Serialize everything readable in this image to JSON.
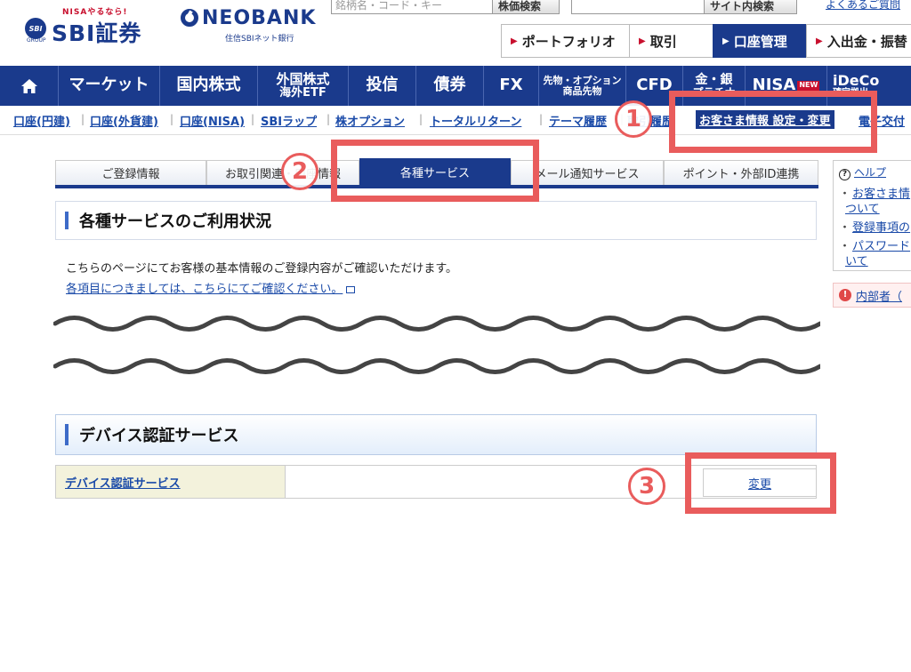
{
  "header": {
    "sbi_logo": {
      "tagline": "NISAやるなら!",
      "emblem": "SBI",
      "emblem_sub": "GROUP",
      "name": "SBI証券"
    },
    "neobank_logo": {
      "name": "NEOBANK",
      "sub": "住信SBIネット銀行"
    },
    "stock_search": {
      "placeholder": "銘柄名・コード・キー",
      "button": "株価検索"
    },
    "site_search": {
      "button": "サイト内検索"
    },
    "faq_link": "よくあるご質問",
    "top_tabs": [
      "ポートフォリオ",
      "取引",
      "口座管理",
      "入出金・振替"
    ],
    "active_top_tab": "口座管理"
  },
  "main_nav": {
    "home_icon": "home-icon",
    "items": [
      {
        "label": "マーケット"
      },
      {
        "label": "国内株式"
      },
      {
        "line1": "外国株式",
        "line2": "海外ETF"
      },
      {
        "label": "投信"
      },
      {
        "label": "債券"
      },
      {
        "label": "FX"
      },
      {
        "line1": "先物・オプション",
        "line2": "商品先物"
      },
      {
        "label": "CFD"
      },
      {
        "line1": "金・銀",
        "line2": "プラチナ"
      },
      {
        "label": "NISA",
        "badge": "NEW"
      },
      {
        "line1": "iDeCo",
        "line2": "確定拠出"
      }
    ]
  },
  "sub_nav": {
    "links": [
      "口座(円建)",
      "口座(外貨建)",
      "口座(NISA)",
      "SBIラップ",
      "株オプション",
      "トータルリターン",
      "テーマ履歴",
      "取引履歴",
      "お客さま情報 設定・変更",
      "電子交付"
    ],
    "active": "お客さま情報 設定・変更"
  },
  "page_tabs": {
    "tabs": [
      "ご登録情報",
      "お取引関連・口座情報",
      "各種サービス",
      "メール通知サービス",
      "ポイント・外部ID連携"
    ],
    "active": "各種サービス"
  },
  "section1": {
    "title": "各種サービスのご利用状況",
    "intro": "こちらのページにてお客様の基本情報のご登録内容がご確認いただけます。",
    "link": "各項目につきましては、こちらにてご確認ください。"
  },
  "section2": {
    "title": "デバイス認証サービス",
    "row_label": "デバイス認証サービス",
    "change_button": "変更"
  },
  "help_panel": {
    "title": "ヘルプ",
    "items": [
      {
        "l1": "お客さま情",
        "l2": "ついて"
      },
      {
        "l1": "登録事項の"
      },
      {
        "l1": "パスワード",
        "l2": "いて"
      }
    ]
  },
  "insider_link": "内部者（",
  "annotations": {
    "step1": "1",
    "step2": "2",
    "step3": "3",
    "highlight_color": "#e95c5c"
  },
  "colors": {
    "brand_navy": "#1a3a8c",
    "link_blue": "#1a4aa8",
    "row_label_bg": "#f3f2dc"
  }
}
